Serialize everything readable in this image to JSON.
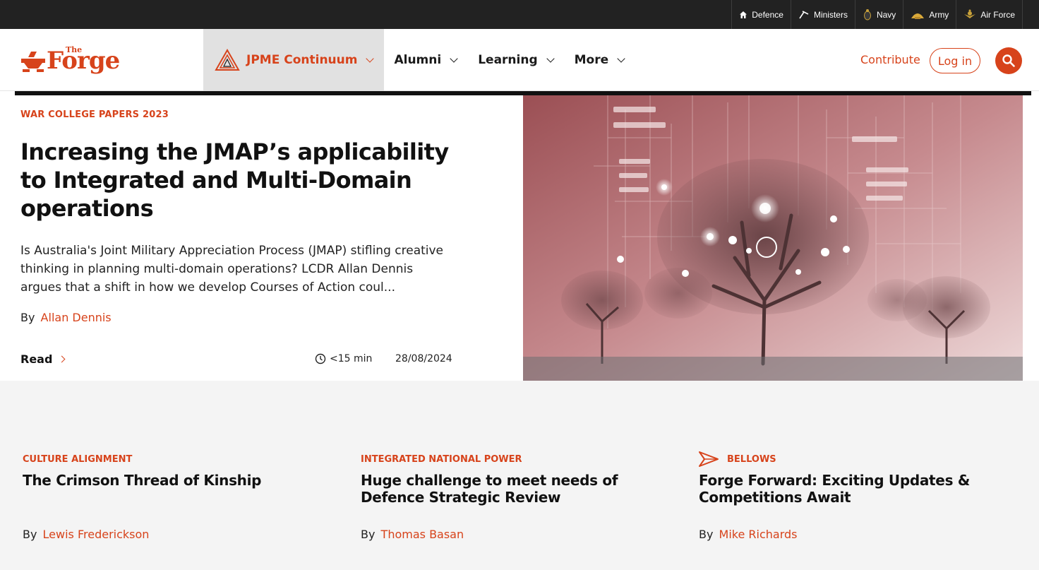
{
  "util_nav": {
    "defence": "Defence",
    "ministers": "Ministers",
    "navy": "Navy",
    "army": "Army",
    "air_force": "Air Force"
  },
  "brand": {
    "the": "The",
    "forge": "Forge"
  },
  "nav": {
    "items": [
      {
        "label": "JPME Continuum",
        "active": true
      },
      {
        "label": "Alumni"
      },
      {
        "label": "Learning"
      },
      {
        "label": "More"
      }
    ],
    "contribute": "Contribute",
    "login": "Log in"
  },
  "feature": {
    "category": "WAR COLLEGE PAPERS 2023",
    "title": "Increasing the JMAP’s applicability to Integrated and Multi-Domain operations",
    "summary": "Is Australia's Joint Military Appreciation Process (JMAP) stifling creative thinking in planning multi-domain operations? LCDR Allan Dennis argues that a shift in how we develop Courses of Action coul...",
    "by": "By",
    "author": "Allan Dennis",
    "read": "Read",
    "read_time": "<15 min",
    "date": "28/08/2024"
  },
  "cards": [
    {
      "category": "CULTURE ALIGNMENT",
      "title": "The Crimson Thread of Kinship",
      "by": "By",
      "author": "Lewis Frederickson"
    },
    {
      "category": "INTEGRATED NATIONAL POWER",
      "title": "Huge challenge to meet needs of Defence Strategic Review",
      "by": "By",
      "author": "Thomas Basan"
    },
    {
      "category": "BELLOWS",
      "title": "Forge Forward: Exciting Updates & Competitions Await",
      "by": "By",
      "author": "Mike Richards"
    }
  ],
  "colors": {
    "accent": "#d7431b",
    "utility_bar": "#222222",
    "active_nav_bg": "#e1e1e1",
    "lower_bg": "#f4f4f4"
  }
}
